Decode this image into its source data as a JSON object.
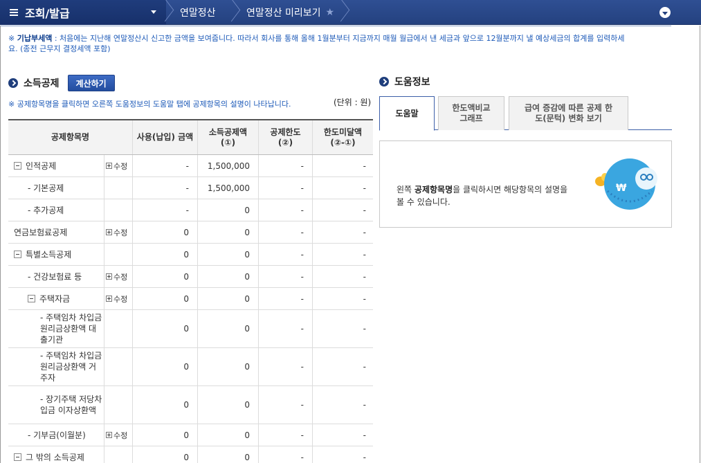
{
  "nav": {
    "menu_title": "조회/발급",
    "crumbs": [
      "연말정산",
      "연말정산 미리보기"
    ]
  },
  "notice": {
    "prefix": "※",
    "bold": "기납부세액",
    "text": " : 처음에는 지난해 연말정산시 신고한 금액을 보여줍니다. 따라서 회사를 통해 올해 1월분부터 지금까지 매월 월급에서 낸 세금과 앞으로 12월분까지 낼 예상세금의 합계를 입력하세요. (종전 근무지 결정세액 포함)"
  },
  "left": {
    "title": "소득공제",
    "calc_button": "계산하기",
    "subnote": "※ 공제항목명을 클릭하면 오른쪽 도움정보의 도움말 탭에 공제항목의 설명이 나타납니다.",
    "unit": "(단위 : 원)"
  },
  "table": {
    "headers": {
      "name": "공제항목명",
      "col1": "사용(납입) 금액",
      "col2": "소득공제액 (①)",
      "col3": "공제한도 (②)",
      "col4": "한도미달액 (②-①)"
    },
    "rows": [
      {
        "name": "인적공제",
        "edit": "수정",
        "v1": "-",
        "v2": "1,500,000",
        "v3": "-",
        "v4": "-"
      },
      {
        "name": "- 기본공제",
        "edit": "",
        "v1": "-",
        "v2": "1,500,000",
        "v3": "-",
        "v4": "-"
      },
      {
        "name": "- 추가공제",
        "edit": "",
        "v1": "-",
        "v2": "0",
        "v3": "-",
        "v4": "-"
      },
      {
        "name": "연금보험료공제",
        "edit": "수정",
        "v1": "0",
        "v2": "0",
        "v3": "-",
        "v4": "-"
      },
      {
        "name": "특별소득공제",
        "edit": "",
        "v1": "0",
        "v2": "0",
        "v3": "-",
        "v4": "-"
      },
      {
        "name": "- 건강보험료 등",
        "edit": "수정",
        "v1": "0",
        "v2": "0",
        "v3": "-",
        "v4": "-"
      },
      {
        "name": "주택자금",
        "edit": "수정",
        "v1": "0",
        "v2": "0",
        "v3": "-",
        "v4": "-"
      },
      {
        "name": "- 주택임차 차입금 원리금상환액 대출기관",
        "edit": "",
        "v1": "0",
        "v2": "0",
        "v3": "-",
        "v4": "-"
      },
      {
        "name": "- 주택임차 차입금 원리금상환액 거주자",
        "edit": "",
        "v1": "0",
        "v2": "0",
        "v3": "-",
        "v4": "-"
      },
      {
        "name": "- 장기주택 저당차입금 이자상환액",
        "edit": "",
        "v1": "0",
        "v2": "0",
        "v3": "-",
        "v4": "-"
      },
      {
        "name": "- 기부금(이월분)",
        "edit": "수정",
        "v1": "0",
        "v2": "0",
        "v3": "-",
        "v4": "-"
      },
      {
        "name": "그 밖의 소득공제",
        "edit": "",
        "v1": "0",
        "v2": "0",
        "v3": "-",
        "v4": "-"
      }
    ]
  },
  "right": {
    "title": "도움정보",
    "tabs": [
      "도움말",
      "한도액비교 그래프",
      "급여 증감에 따른 공제 한도(문턱) 변화 보기"
    ],
    "help_pre": "왼쪽 ",
    "help_bold": "공제항목명",
    "help_post": "을 클릭하시면 해당항목의 설명을 볼 수 있습니다.",
    "mascot_symbol": "₩"
  },
  "colors": {
    "nav_bg": "#24417f",
    "accent_blue": "#1d5ab8",
    "mascot": "#3aa6e0"
  }
}
